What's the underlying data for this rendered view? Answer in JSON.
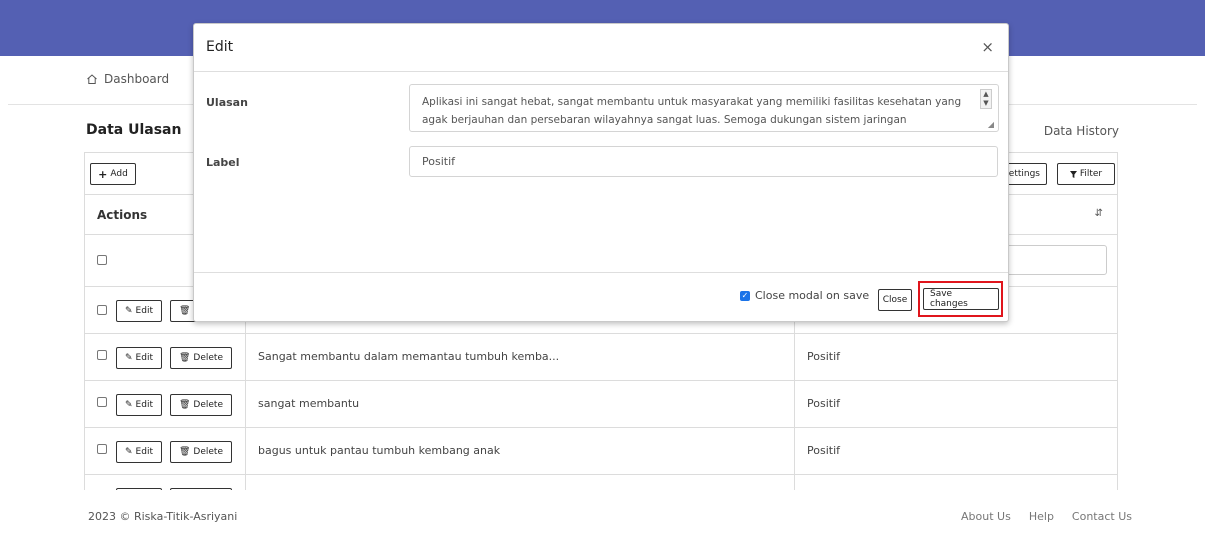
{
  "breadcrumb": {
    "home_label": "Dashboard"
  },
  "page": {
    "title": "Data Ulasan",
    "history_link": "Data History"
  },
  "toolbar": {
    "add_label": "Add",
    "settings_label": "ettings",
    "filter_label": "Filter"
  },
  "table": {
    "actions_header": "Actions",
    "edit_label": "Edit",
    "delete_label": "Delete",
    "rows": [
      {
        "text": "",
        "label": ""
      },
      {
        "text": "Sangat membantu dalam memantau tumbuh kemba...",
        "label": "Positif"
      },
      {
        "text": "sangat membantu",
        "label": "Positif"
      },
      {
        "text": "bagus untuk pantau tumbuh kembang anak",
        "label": "Positif"
      }
    ]
  },
  "modal": {
    "title": "Edit",
    "close_symbol": "×",
    "ulasan_label": "Ulasan",
    "ulasan_value": "Aplikasi ini sangat hebat, sangat membantu untuk masyarakat yang memiliki fasilitas kesehatan yang agak berjauhan dan persebaran wilayahnya sangat luas. Semoga dukungan sistem jaringan telekomunikasi dapat terus ditingkatkan agar aplikasi ini semakin bermanfaat.",
    "label_label": "Label",
    "label_value": "Positif",
    "close_on_save_label": "Close modal on save",
    "close_on_save_checked": true,
    "close_button": "Close",
    "save_button": "Save changes",
    "highlight_color": "#e0151c"
  },
  "footer": {
    "copyright": "2023 © Riska-Titik-Asriyani",
    "links": [
      "About Us",
      "Help",
      "Contact Us"
    ]
  },
  "colors": {
    "topbar": "#5460b3",
    "checkbox_accent": "#1a73e8"
  }
}
